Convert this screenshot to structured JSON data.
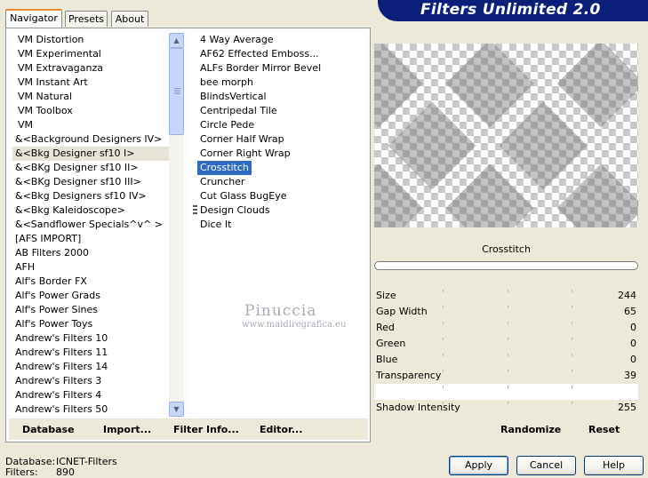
{
  "header": {
    "title": "Filters Unlimited 2.0"
  },
  "tabs": [
    {
      "label": "Navigator",
      "active": true
    },
    {
      "label": "Presets",
      "active": false
    },
    {
      "label": "About",
      "active": false
    }
  ],
  "categories": {
    "items": [
      "VM Distortion",
      "VM Experimental",
      "VM Extravaganza",
      "VM Instant Art",
      "VM Natural",
      "VM Toolbox",
      "VM",
      "&<Background Designers IV>",
      "&<Bkg Designer sf10 I>",
      "&<BKg Designer sf10 II>",
      "&<BKg Designer sf10 III>",
      "&<Bkg Designers sf10 IV>",
      "&<Bkg Kaleidoscope>",
      "&<Sandflower Specials^v^ >",
      "[AFS IMPORT]",
      "AB Filters 2000",
      "AFH",
      "Alf's Border FX",
      "Alf's Power Grads",
      "Alf's Power Sines",
      "Alf's Power Toys",
      "Andrew's Filters 10",
      "Andrew's Filters 11",
      "Andrew's Filters 14",
      "Andrew's Filters 3",
      "Andrew's Filters 4",
      "Andrew's Filters 50"
    ],
    "highlighted": "&<Bkg Designer sf10 I>"
  },
  "filters": {
    "items": [
      "4 Way Average",
      "AF62 Effected Emboss...",
      "ALFs Border Mirror Bevel",
      "bee morph",
      "BlindsVertical",
      "Centripedal Tile",
      "Circle Pede",
      "Corner Half Wrap",
      "Corner Right Wrap",
      "Crosstitch",
      "Cruncher",
      "Cut Glass  BugEye",
      "Design Clouds",
      "Dice It"
    ],
    "selected": "Crosstitch"
  },
  "left_buttons": {
    "database": "Database",
    "import": "Import...",
    "filter_info": "Filter Info...",
    "editor": "Editor..."
  },
  "preview": {
    "filter_name": "Crosstitch"
  },
  "parameters": [
    {
      "label": "Size",
      "value": "244"
    },
    {
      "label": "Gap Width",
      "value": "65"
    },
    {
      "label": "Red",
      "value": "0"
    },
    {
      "label": "Green",
      "value": "0"
    },
    {
      "label": "Blue",
      "value": "0"
    },
    {
      "label": "Transparency",
      "value": "39"
    },
    {
      "label": "",
      "value": ""
    },
    {
      "label": "Shadow Intensity",
      "value": "255"
    }
  ],
  "right_buttons": {
    "randomize": "Randomize",
    "reset": "Reset"
  },
  "footer": {
    "database_label": "Database:",
    "database_value": "ICNET-Filters",
    "filters_label": "Filters:",
    "filters_value": "890"
  },
  "dialog_buttons": {
    "apply": "Apply",
    "cancel": "Cancel",
    "help": "Help"
  },
  "watermark": {
    "line1": "Pinuccia",
    "line2": "www.maidiregrafica.eu"
  }
}
